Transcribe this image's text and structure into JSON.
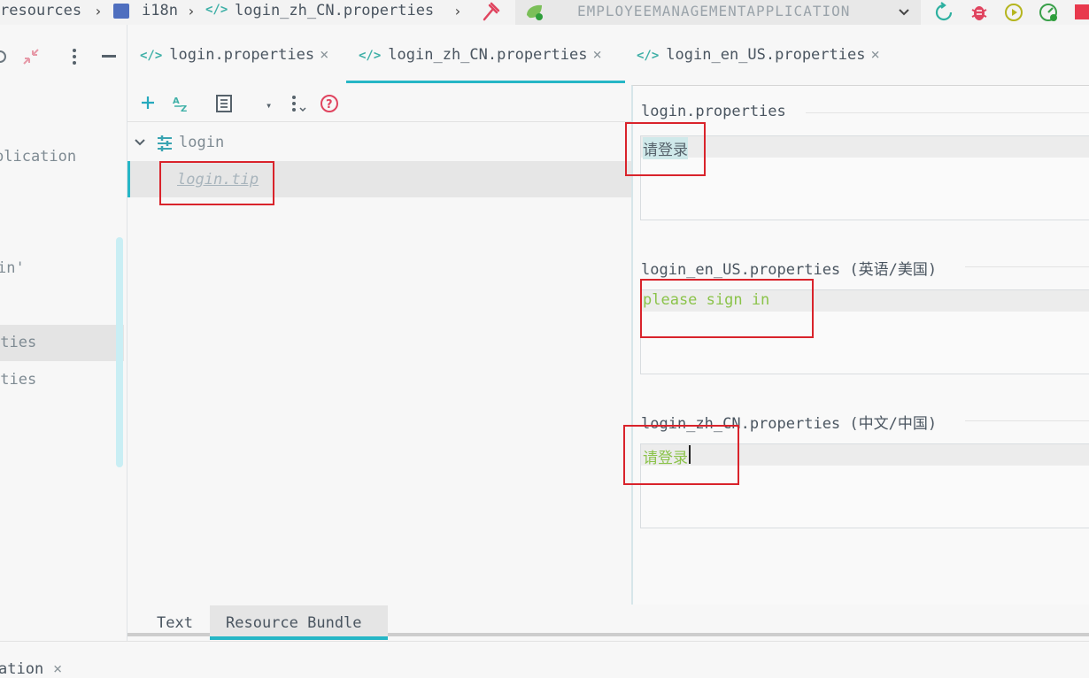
{
  "breadcrumb": {
    "items": [
      "resources",
      "i18n",
      "login_zh_CN.properties"
    ],
    "run_config": "EMPLOYEEMANAGEMENTAPPLICATION"
  },
  "left_panel": {
    "lines": [
      "plication",
      "in'",
      "rties",
      "rties"
    ]
  },
  "tabs": [
    {
      "label": "login.properties",
      "active": false
    },
    {
      "label": "login_zh_CN.properties",
      "active": true
    },
    {
      "label": "login_en_US.properties",
      "active": false
    }
  ],
  "tree": {
    "group": "login",
    "keys": [
      "login.tip"
    ]
  },
  "editors": [
    {
      "title": "login.properties",
      "value": "请登录"
    },
    {
      "title": "login_en_US.properties (英语/美国)",
      "value": "please sign in"
    },
    {
      "title": "login_zh_CN.properties (中文/中国)",
      "value": "请登录"
    }
  ],
  "bottom_tabs": [
    "Text",
    "Resource Bundle"
  ],
  "bottom_strip": {
    "label": "ation"
  },
  "colors": {
    "accent": "#26b6c6",
    "annotation_red": "#d9232b",
    "value_green": "#8bc34a",
    "icon_teal": "#3fb0a7"
  }
}
